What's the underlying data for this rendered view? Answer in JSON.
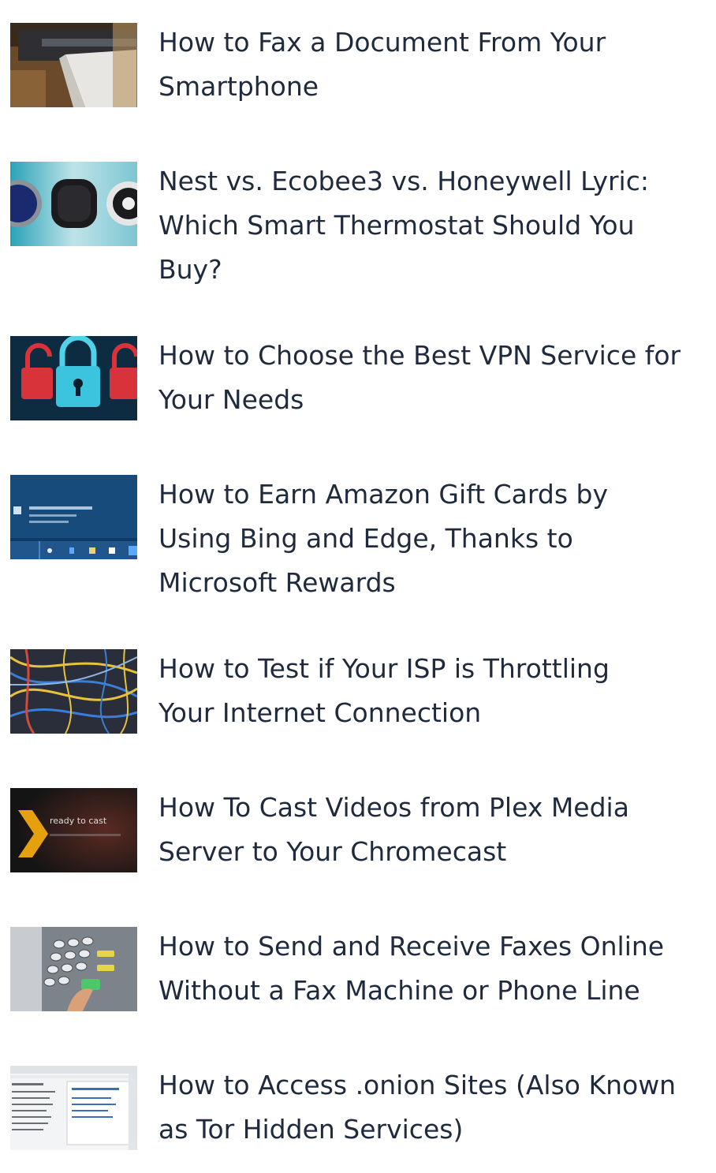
{
  "articles": [
    {
      "lines": [
        "How to Fax a Document From Your",
        "Smartphone"
      ],
      "thumb_icon": "fax-machine-thumbnail"
    },
    {
      "lines": [
        "Nest vs. Ecobee3 vs. Honeywell Lyric:",
        "Which Smart Thermostat Should You",
        "Buy?"
      ],
      "thumb_icon": "thermostats-thumbnail"
    },
    {
      "lines": [
        "How to Choose the Best VPN Service for",
        "Your Needs"
      ],
      "thumb_icon": "padlocks-thumbnail"
    },
    {
      "lines": [
        "How to Earn Amazon Gift Cards by",
        "Using Bing and Edge, Thanks to",
        "Microsoft Rewards"
      ],
      "thumb_icon": "windows-taskbar-thumbnail"
    },
    {
      "lines": [
        "How to Test if Your ISP is Throttling",
        "Your Internet Connection"
      ],
      "thumb_icon": "network-cables-thumbnail"
    },
    {
      "lines": [
        "How To Cast Videos from Plex Media",
        "Server to Your Chromecast"
      ],
      "thumb_icon": "plex-cast-thumbnail"
    },
    {
      "lines": [
        "How to Send and Receive Faxes Online",
        "Without a Fax Machine or Phone Line"
      ],
      "thumb_icon": "fax-keypad-thumbnail"
    },
    {
      "lines": [
        "How to Access .onion Sites (Also Known",
        "as Tor Hidden Services)"
      ],
      "thumb_icon": "tor-browser-screenshot-thumbnail"
    }
  ],
  "thumb_texts": {
    "cast": "ready to cast"
  }
}
